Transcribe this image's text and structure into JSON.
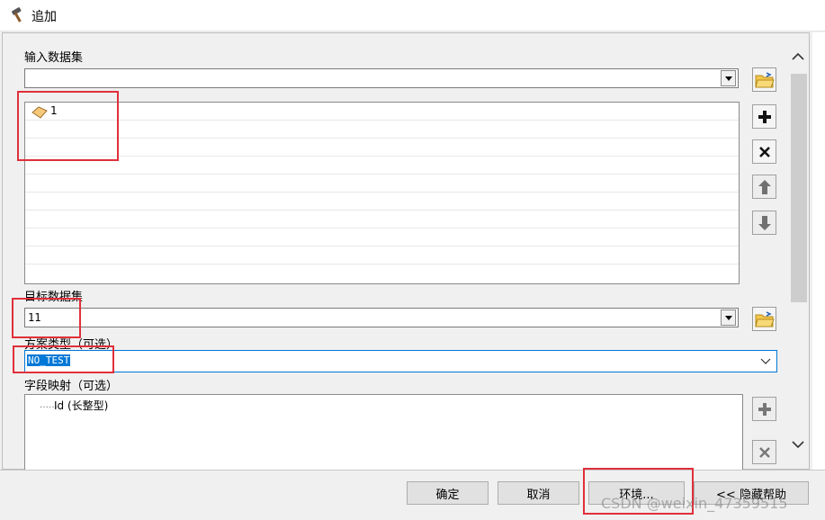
{
  "window": {
    "title": "追加",
    "title_icon": "hammer-icon"
  },
  "input_datasets": {
    "label": "输入数据集",
    "combo_value": "",
    "items": [
      {
        "name": "1",
        "icon": "polygon-feature-icon"
      }
    ]
  },
  "target_dataset": {
    "label": "目标数据集",
    "value": "11"
  },
  "schema_type": {
    "label": "方案类型（可选）",
    "value": "NO_TEST"
  },
  "field_map": {
    "label": "字段映射（可选）",
    "items": [
      {
        "prefix": "……",
        "name": "Id (长整型)"
      }
    ]
  },
  "side_buttons": {
    "add": "plus-icon",
    "remove": "close-icon",
    "up": "arrow-up-icon",
    "down": "arrow-down-icon"
  },
  "footer": {
    "ok": "确定",
    "cancel": "取消",
    "environments": "环境...",
    "hide_help": "<< 隐藏帮助"
  },
  "watermark": "CSDN @weixin_47359515",
  "colors": {
    "highlight_box": "#e0303a",
    "selection": "#0078d7",
    "focus_border": "#0078d7"
  }
}
